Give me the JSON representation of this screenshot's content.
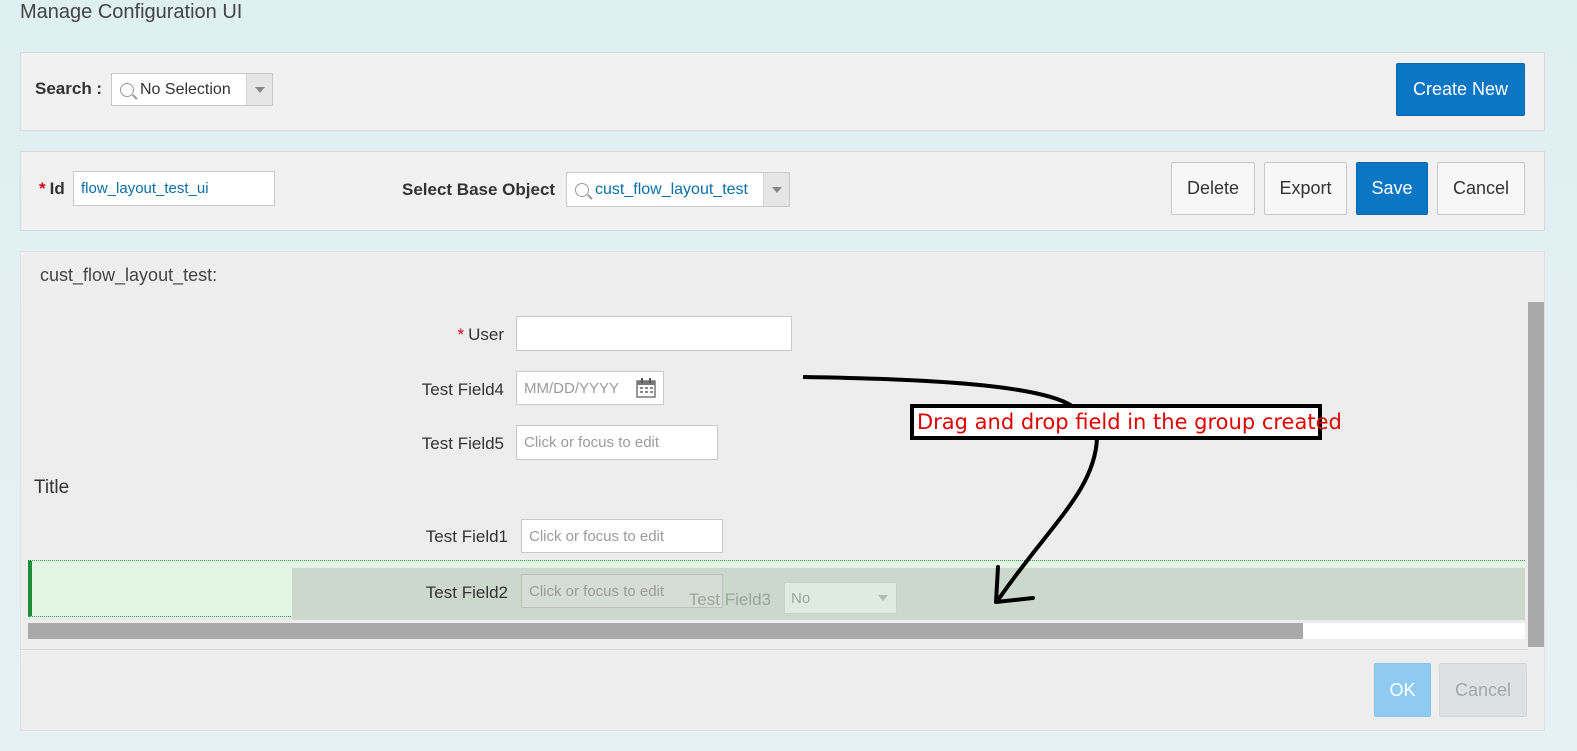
{
  "window": {
    "title": "Manage Configuration UI"
  },
  "search": {
    "label": "Search :",
    "value": "No Selection",
    "create_new_label": "Create New"
  },
  "config": {
    "id_label": "Id",
    "id_value": "flow_layout_test_ui",
    "base_object_label": "Select Base Object",
    "base_object_value": "cust_flow_layout_test",
    "actions": {
      "delete": "Delete",
      "export": "Export",
      "save": "Save",
      "cancel": "Cancel"
    }
  },
  "layout": {
    "section_title": "cust_flow_layout_test:",
    "fields": {
      "user": {
        "label": "User",
        "required": true,
        "value": ""
      },
      "test_field4": {
        "label": "Test Field4",
        "placeholder": "MM/DD/YYYY"
      },
      "test_field5": {
        "label": "Test Field5",
        "placeholder": "Click or focus to edit"
      }
    },
    "group": {
      "title": "Title",
      "test_field1": {
        "label": "Test Field1",
        "placeholder": "Click or focus to edit"
      },
      "test_field2": {
        "label": "Test Field2",
        "placeholder": "Click or focus to edit"
      },
      "test_field3": {
        "label": "Test Field3",
        "value": "No"
      }
    }
  },
  "annotation": {
    "text": "Drag and drop field in the group created"
  },
  "footer": {
    "ok_label": "OK",
    "cancel_label": "Cancel"
  },
  "colors": {
    "primary": "#0a76c4",
    "required": "#d0021b",
    "drop_highlight": "#1f8e3a",
    "annotation": "#e00000"
  }
}
